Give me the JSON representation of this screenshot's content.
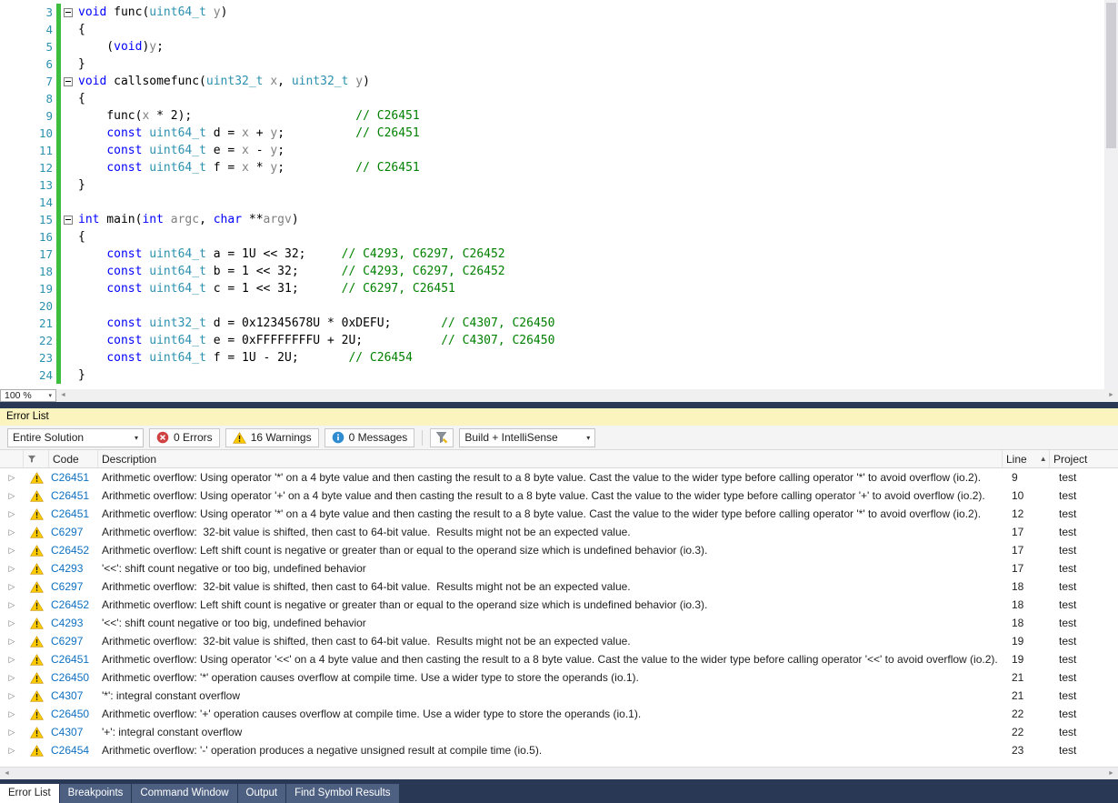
{
  "colors": {
    "keyword": "#0000FF",
    "type_teal": "#2B91AF",
    "identifier_gray": "#808080",
    "comment_green": "#008000",
    "line_number": "#2B91AF",
    "change_bar_green": "#3EBE3E",
    "link_blue": "#0E70C0",
    "warning_yellow": "#FFCC00",
    "error_red": "#CF4242",
    "info_blue": "#2E8BD0",
    "panel_header_yellow": "#FBF4BE",
    "tabbar_navy": "#293955",
    "inactive_tab_blue": "#4D6082"
  },
  "icons": {
    "warning": "yellow-triangle-exclamation",
    "error": "red-circle-x",
    "message": "blue-circle-i",
    "filter": "funnel-with-pencil",
    "severity_header": "small-funnel",
    "expander": "▷",
    "combo_caret": "▾",
    "sort_ascending": "▲",
    "fold_collapse": "minus-box",
    "scroll_left_arrow": "◄",
    "scroll_right_arrow": "►"
  },
  "editor": {
    "zoom": "100 %",
    "lines": [
      {
        "num": "3",
        "fold": true,
        "tokens": [
          {
            "t": "void",
            "c": "kw"
          },
          {
            "t": " func(",
            "c": "pl"
          },
          {
            "t": "uint64_t",
            "c": "ty"
          },
          {
            "t": " ",
            "c": "pl"
          },
          {
            "t": "y",
            "c": "id"
          },
          {
            "t": ")",
            "c": "pl"
          }
        ]
      },
      {
        "num": "4",
        "tokens": [
          {
            "t": "{",
            "c": "pl"
          }
        ]
      },
      {
        "num": "5",
        "tokens": [
          {
            "t": "    (",
            "c": "pl"
          },
          {
            "t": "void",
            "c": "kw"
          },
          {
            "t": ")",
            "c": "pl"
          },
          {
            "t": "y",
            "c": "id"
          },
          {
            "t": ";",
            "c": "pl"
          }
        ]
      },
      {
        "num": "6",
        "tokens": [
          {
            "t": "}",
            "c": "pl"
          }
        ]
      },
      {
        "num": "7",
        "fold": true,
        "tokens": [
          {
            "t": "void",
            "c": "kw"
          },
          {
            "t": " callsomefunc(",
            "c": "pl"
          },
          {
            "t": "uint32_t",
            "c": "ty"
          },
          {
            "t": " ",
            "c": "pl"
          },
          {
            "t": "x",
            "c": "id"
          },
          {
            "t": ", ",
            "c": "pl"
          },
          {
            "t": "uint32_t",
            "c": "ty"
          },
          {
            "t": " ",
            "c": "pl"
          },
          {
            "t": "y",
            "c": "id"
          },
          {
            "t": ")",
            "c": "pl"
          }
        ]
      },
      {
        "num": "8",
        "tokens": [
          {
            "t": "{",
            "c": "pl"
          }
        ]
      },
      {
        "num": "9",
        "tokens": [
          {
            "t": "    func(",
            "c": "pl"
          },
          {
            "t": "x",
            "c": "id"
          },
          {
            "t": " * 2);",
            "c": "pl"
          },
          {
            "t": "                       ",
            "c": "pl"
          },
          {
            "t": "// C26451",
            "c": "cm"
          }
        ]
      },
      {
        "num": "10",
        "tokens": [
          {
            "t": "    ",
            "c": "pl"
          },
          {
            "t": "const",
            "c": "kw"
          },
          {
            "t": " ",
            "c": "pl"
          },
          {
            "t": "uint64_t",
            "c": "ty"
          },
          {
            "t": " d = ",
            "c": "pl"
          },
          {
            "t": "x",
            "c": "id"
          },
          {
            "t": " + ",
            "c": "pl"
          },
          {
            "t": "y",
            "c": "id"
          },
          {
            "t": ";",
            "c": "pl"
          },
          {
            "t": "          ",
            "c": "pl"
          },
          {
            "t": "// C26451",
            "c": "cm"
          }
        ]
      },
      {
        "num": "11",
        "tokens": [
          {
            "t": "    ",
            "c": "pl"
          },
          {
            "t": "const",
            "c": "kw"
          },
          {
            "t": " ",
            "c": "pl"
          },
          {
            "t": "uint64_t",
            "c": "ty"
          },
          {
            "t": " e = ",
            "c": "pl"
          },
          {
            "t": "x",
            "c": "id"
          },
          {
            "t": " - ",
            "c": "pl"
          },
          {
            "t": "y",
            "c": "id"
          },
          {
            "t": ";",
            "c": "pl"
          }
        ]
      },
      {
        "num": "12",
        "tokens": [
          {
            "t": "    ",
            "c": "pl"
          },
          {
            "t": "const",
            "c": "kw"
          },
          {
            "t": " ",
            "c": "pl"
          },
          {
            "t": "uint64_t",
            "c": "ty"
          },
          {
            "t": " f = ",
            "c": "pl"
          },
          {
            "t": "x",
            "c": "id"
          },
          {
            "t": " * ",
            "c": "pl"
          },
          {
            "t": "y",
            "c": "id"
          },
          {
            "t": ";",
            "c": "pl"
          },
          {
            "t": "          ",
            "c": "pl"
          },
          {
            "t": "// C26451",
            "c": "cm"
          }
        ]
      },
      {
        "num": "13",
        "tokens": [
          {
            "t": "}",
            "c": "pl"
          }
        ]
      },
      {
        "num": "14",
        "tokens": []
      },
      {
        "num": "15",
        "fold": true,
        "tokens": [
          {
            "t": "int",
            "c": "kw"
          },
          {
            "t": " main(",
            "c": "pl"
          },
          {
            "t": "int",
            "c": "kw"
          },
          {
            "t": " ",
            "c": "pl"
          },
          {
            "t": "argc",
            "c": "id"
          },
          {
            "t": ", ",
            "c": "pl"
          },
          {
            "t": "char",
            "c": "kw"
          },
          {
            "t": " **",
            "c": "pl"
          },
          {
            "t": "argv",
            "c": "id"
          },
          {
            "t": ")",
            "c": "pl"
          }
        ]
      },
      {
        "num": "16",
        "tokens": [
          {
            "t": "{",
            "c": "pl"
          }
        ]
      },
      {
        "num": "17",
        "tokens": [
          {
            "t": "    ",
            "c": "pl"
          },
          {
            "t": "const",
            "c": "kw"
          },
          {
            "t": " ",
            "c": "pl"
          },
          {
            "t": "uint64_t",
            "c": "ty"
          },
          {
            "t": " a = 1U << 32;",
            "c": "pl"
          },
          {
            "t": "     ",
            "c": "pl"
          },
          {
            "t": "// C4293, C6297, C26452",
            "c": "cm"
          }
        ]
      },
      {
        "num": "18",
        "tokens": [
          {
            "t": "    ",
            "c": "pl"
          },
          {
            "t": "const",
            "c": "kw"
          },
          {
            "t": " ",
            "c": "pl"
          },
          {
            "t": "uint64_t",
            "c": "ty"
          },
          {
            "t": " b = 1 << 32;",
            "c": "pl"
          },
          {
            "t": "      ",
            "c": "pl"
          },
          {
            "t": "// C4293, C6297, C26452",
            "c": "cm"
          }
        ]
      },
      {
        "num": "19",
        "tokens": [
          {
            "t": "    ",
            "c": "pl"
          },
          {
            "t": "const",
            "c": "kw"
          },
          {
            "t": " ",
            "c": "pl"
          },
          {
            "t": "uint64_t",
            "c": "ty"
          },
          {
            "t": " c = 1 << 31;",
            "c": "pl"
          },
          {
            "t": "      ",
            "c": "pl"
          },
          {
            "t": "// C6297, C26451",
            "c": "cm"
          }
        ]
      },
      {
        "num": "20",
        "tokens": []
      },
      {
        "num": "21",
        "tokens": [
          {
            "t": "    ",
            "c": "pl"
          },
          {
            "t": "const",
            "c": "kw"
          },
          {
            "t": " ",
            "c": "pl"
          },
          {
            "t": "uint32_t",
            "c": "ty"
          },
          {
            "t": " d = 0x12345678U * 0xDEFU;",
            "c": "pl"
          },
          {
            "t": "       ",
            "c": "pl"
          },
          {
            "t": "// C4307, C26450",
            "c": "cm"
          }
        ]
      },
      {
        "num": "22",
        "tokens": [
          {
            "t": "    ",
            "c": "pl"
          },
          {
            "t": "const",
            "c": "kw"
          },
          {
            "t": " ",
            "c": "pl"
          },
          {
            "t": "uint64_t",
            "c": "ty"
          },
          {
            "t": " e = 0xFFFFFFFFU + 2U;",
            "c": "pl"
          },
          {
            "t": "           ",
            "c": "pl"
          },
          {
            "t": "// C4307, C26450",
            "c": "cm"
          }
        ]
      },
      {
        "num": "23",
        "tokens": [
          {
            "t": "    ",
            "c": "pl"
          },
          {
            "t": "const",
            "c": "kw"
          },
          {
            "t": " ",
            "c": "pl"
          },
          {
            "t": "uint64_t",
            "c": "ty"
          },
          {
            "t": " f = 1U - 2U;",
            "c": "pl"
          },
          {
            "t": "       ",
            "c": "pl"
          },
          {
            "t": "// C26454",
            "c": "cm"
          }
        ]
      },
      {
        "num": "24",
        "tokens": [
          {
            "t": "}",
            "c": "pl"
          }
        ]
      }
    ]
  },
  "error_list": {
    "title": "Error List",
    "toolbar": {
      "scope": "Entire Solution",
      "errors": "0 Errors",
      "warnings": "16 Warnings",
      "messages": "0 Messages",
      "source": "Build + IntelliSense"
    },
    "columns": {
      "code": "Code",
      "description": "Description",
      "line": "Line",
      "project": "Project"
    },
    "rows": [
      {
        "code": "C26451",
        "description": "Arithmetic overflow: Using operator '*' on a 4 byte value and then casting the result to a 8 byte value. Cast the value to the wider type before calling operator '*' to avoid overflow (io.2).",
        "line": "9",
        "project": "test"
      },
      {
        "code": "C26451",
        "description": "Arithmetic overflow: Using operator '+' on a 4 byte value and then casting the result to a 8 byte value. Cast the value to the wider type before calling operator '+' to avoid overflow (io.2).",
        "line": "10",
        "project": "test"
      },
      {
        "code": "C26451",
        "description": "Arithmetic overflow: Using operator '*' on a 4 byte value and then casting the result to a 8 byte value. Cast the value to the wider type before calling operator '*' to avoid overflow (io.2).",
        "line": "12",
        "project": "test"
      },
      {
        "code": "C6297",
        "description": "Arithmetic overflow:  32-bit value is shifted, then cast to 64-bit value.  Results might not be an expected value.",
        "line": "17",
        "project": "test"
      },
      {
        "code": "C26452",
        "description": "Arithmetic overflow: Left shift count is negative or greater than or equal to the operand size which is undefined behavior (io.3).",
        "line": "17",
        "project": "test"
      },
      {
        "code": "C4293",
        "description": "'<<': shift count negative or too big, undefined behavior",
        "line": "17",
        "project": "test"
      },
      {
        "code": "C6297",
        "description": "Arithmetic overflow:  32-bit value is shifted, then cast to 64-bit value.  Results might not be an expected value.",
        "line": "18",
        "project": "test"
      },
      {
        "code": "C26452",
        "description": "Arithmetic overflow: Left shift count is negative or greater than or equal to the operand size which is undefined behavior (io.3).",
        "line": "18",
        "project": "test"
      },
      {
        "code": "C4293",
        "description": "'<<': shift count negative or too big, undefined behavior",
        "line": "18",
        "project": "test"
      },
      {
        "code": "C6297",
        "description": "Arithmetic overflow:  32-bit value is shifted, then cast to 64-bit value.  Results might not be an expected value.",
        "line": "19",
        "project": "test"
      },
      {
        "code": "C26451",
        "description": "Arithmetic overflow: Using operator '<<' on a 4 byte value and then casting the result to a 8 byte value. Cast the value to the wider type before calling operator '<<' to avoid overflow (io.2).",
        "line": "19",
        "project": "test"
      },
      {
        "code": "C26450",
        "description": "Arithmetic overflow: '*' operation causes overflow at compile time. Use a wider type to store the operands (io.1).",
        "line": "21",
        "project": "test"
      },
      {
        "code": "C4307",
        "description": "'*': integral constant overflow",
        "line": "21",
        "project": "test"
      },
      {
        "code": "C26450",
        "description": "Arithmetic overflow: '+' operation causes overflow at compile time. Use a wider type to store the operands (io.1).",
        "line": "22",
        "project": "test"
      },
      {
        "code": "C4307",
        "description": "'+': integral constant overflow",
        "line": "22",
        "project": "test"
      },
      {
        "code": "C26454",
        "description": "Arithmetic overflow: '-' operation produces a negative unsigned result at compile time (io.5).",
        "line": "23",
        "project": "test"
      }
    ]
  },
  "bottom_tabs": [
    {
      "label": "Error List",
      "active": true
    },
    {
      "label": "Breakpoints",
      "active": false
    },
    {
      "label": "Command Window",
      "active": false
    },
    {
      "label": "Output",
      "active": false
    },
    {
      "label": "Find Symbol Results",
      "active": false
    }
  ]
}
